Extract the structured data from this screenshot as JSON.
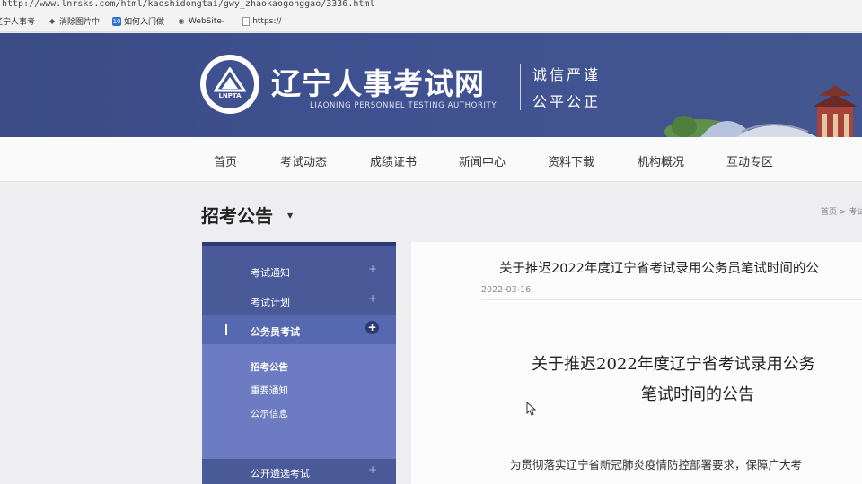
{
  "browser": {
    "url": "http://www.lnrsks.com/html/kaoshidongtai/gwy_zhaokaogonggao/3336.html",
    "bookmarks": [
      {
        "label": "辽宁人事考",
        "icon": "site-icon"
      },
      {
        "label": "消除图片中",
        "icon": "eye-icon"
      },
      {
        "label": "如何入门做",
        "icon": "tencent-icon"
      },
      {
        "label": "WebSite-",
        "icon": "eye-icon"
      },
      {
        "label": "https://",
        "icon": "page-icon"
      }
    ]
  },
  "header": {
    "logo_abbr": "LNPTA",
    "title": "辽宁人事考试网",
    "subtitle": "LIAONING PERSONNEL TESTING AUTHORITY",
    "motto_line1": "诚信严谨",
    "motto_line2": "公平公正",
    "colors": {
      "brand": "#3f5190",
      "nav_active": "#5668b0",
      "sub_panel": "#6d7cc2"
    }
  },
  "nav": {
    "items": [
      "首页",
      "考试动态",
      "成绩证书",
      "新闻中心",
      "资料下载",
      "机构概况",
      "互动专区"
    ]
  },
  "page": {
    "section_title": "招考公告",
    "breadcrumb": "首页 > 考试"
  },
  "sidebar": {
    "items": [
      {
        "label": "考试通知",
        "expand": "+"
      },
      {
        "label": "考试计划",
        "expand": "+"
      },
      {
        "label": "公务员考试",
        "expand": "+"
      }
    ],
    "sub_items": [
      "招考公告",
      "重要通知",
      "公示信息"
    ],
    "bottom_item": {
      "label": "公开遴选考试",
      "expand": "+"
    }
  },
  "article": {
    "title": "关于推迟2022年度辽宁省考试录用公务员笔试时间的公",
    "date": "2022-03-16",
    "heading_line1": "关于推迟2022年度辽宁省考试录用公务",
    "heading_line2": "笔试时间的公告",
    "body_start": "为贯彻落实辽宁省新冠肺炎疫情防控部署要求，保障广大考"
  }
}
